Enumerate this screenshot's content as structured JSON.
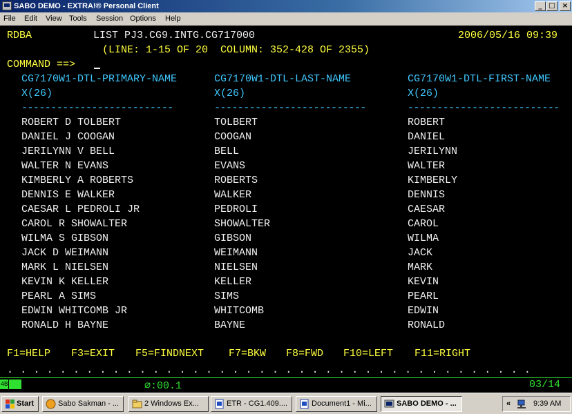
{
  "window": {
    "title": "SABO DEMO - EXTRA!® Personal Client",
    "minimize_label": "_",
    "restore_label": "□",
    "close_label": "×"
  },
  "menu": [
    "File",
    "Edit",
    "View",
    "Tools",
    "Session",
    "Options",
    "Help"
  ],
  "terminal": {
    "system_id": "RDBA",
    "list_title": "LIST PJ3.CG9.INTG.CG717000",
    "datetime": "2006/05/16 09:39",
    "position_info": "(LINE: 1-15 OF 20  COLUMN: 352-428 OF 2355)",
    "command_prompt": "COMMAND ==>",
    "columns": [
      {
        "name": "CG7170W1-DTL-PRIMARY-NAME",
        "format": "X(26)",
        "rule": "--------------------------"
      },
      {
        "name": "CG7170W1-DTL-LAST-NAME",
        "format": "X(26)",
        "rule": "--------------------------"
      },
      {
        "name": "CG7170W1-DTL-FIRST-NAME",
        "format": "X(26)",
        "rule": "--------------------------"
      }
    ],
    "rows": [
      [
        "ROBERT D TOLBERT",
        "TOLBERT",
        "ROBERT"
      ],
      [
        "DANIEL J COOGAN",
        "COOGAN",
        "DANIEL"
      ],
      [
        "JERILYNN V BELL",
        "BELL",
        "JERILYNN"
      ],
      [
        "WALTER N EVANS",
        "EVANS",
        "WALTER"
      ],
      [
        "KIMBERLY A ROBERTS",
        "ROBERTS",
        "KIMBERLY"
      ],
      [
        "DENNIS E WALKER",
        "WALKER",
        "DENNIS"
      ],
      [
        "CAESAR L PEDROLI JR",
        "PEDROLI",
        "CAESAR"
      ],
      [
        "CAROL R SHOWALTER",
        "SHOWALTER",
        "CAROL"
      ],
      [
        "WILMA S GIBSON",
        "GIBSON",
        "WILMA"
      ],
      [
        "JACK D WEIMANN",
        "WEIMANN",
        "JACK"
      ],
      [
        "MARK L NIELSEN",
        "NIELSEN",
        "MARK"
      ],
      [
        "KEVIN K KELLER",
        "KELLER",
        "KEVIN"
      ],
      [
        "PEARL A SIMS",
        "SIMS",
        "PEARL"
      ],
      [
        "EDWIN WHITCOMB JR",
        "WHITCOMB",
        "EDWIN"
      ],
      [
        "RONALD H BAYNE",
        "BAYNE",
        "RONALD"
      ]
    ],
    "function_keys": [
      "F1=HELP",
      "F3=EXIT",
      "F5=FINDNEXT",
      "F7=BKW",
      "F8=FWD",
      "F10=LEFT",
      "F11=RIGHT"
    ],
    "dot_line": ". . . . . . . . . . . . . . . . . . . . . . . . . . . . . . . . . . . . . . . ."
  },
  "status": {
    "indicator": "4B",
    "timer": "⌀:00.1",
    "cursor_pos": "03/14"
  },
  "taskbar": {
    "start_label": "Start",
    "items": [
      {
        "label": "Sabo Sakman - ...",
        "icon": "messenger-icon"
      },
      {
        "label": "2 Windows Ex...",
        "icon": "folder-icon"
      },
      {
        "label": "ETR - CG1.409....",
        "icon": "word-document-icon"
      },
      {
        "label": "Document1 - Mi...",
        "icon": "word-document-icon"
      },
      {
        "label": "SABO DEMO - ...",
        "icon": "terminal-icon",
        "active": true
      }
    ],
    "tray_chevron": "«",
    "clock": "9:39 AM"
  },
  "colors": {
    "title_bar": "#0a246a",
    "terminal_bg": "#000000",
    "yellow_text": "#ffff40",
    "cyan_text": "#40c8ff",
    "white_text": "#f0f0f0",
    "status_green": "#30e030"
  }
}
